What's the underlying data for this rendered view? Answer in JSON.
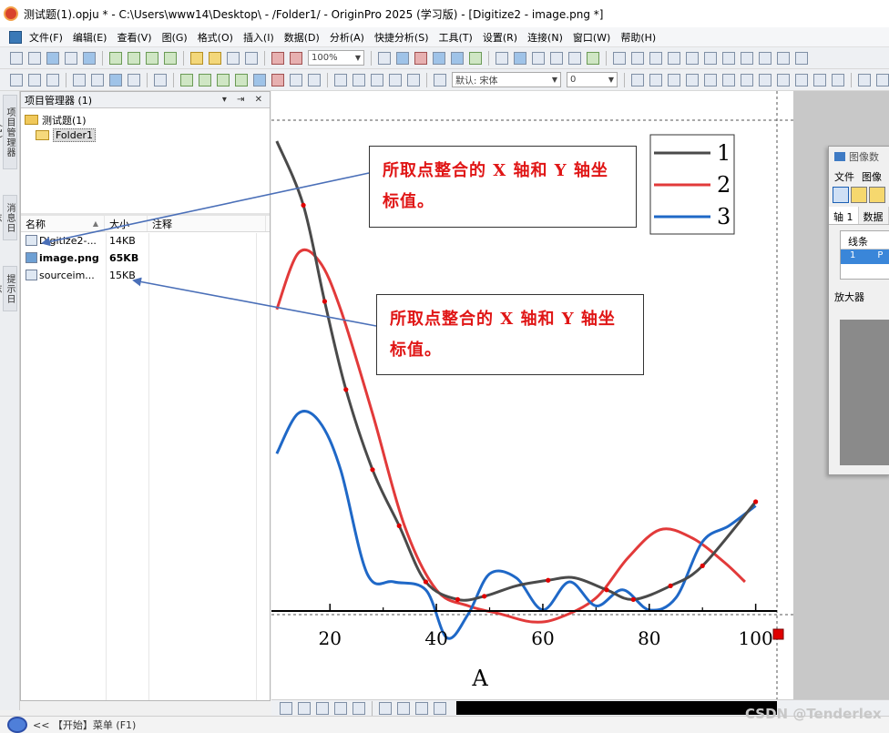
{
  "window": {
    "title": "测试题(1).opju * - C:\\Users\\www14\\Desktop\\ - /Folder1/ - OriginPro 2025 (学习版) - [Digitize2 - image.png *]"
  },
  "menu": [
    "文件(F)",
    "编辑(E)",
    "查看(V)",
    "图(G)",
    "格式(O)",
    "插入(I)",
    "数据(D)",
    "分析(A)",
    "快捷分析(S)",
    "工具(T)",
    "设置(R)",
    "连接(N)",
    "窗口(W)",
    "帮助(H)"
  ],
  "toolbar": {
    "zoom_value": "100%",
    "font_label": "默认: 宋体",
    "font_size": "0"
  },
  "side_tabs": [
    "项目管理器 (1)",
    "消息日志",
    "提示日志"
  ],
  "project_explorer": {
    "title": "项目管理器 (1)",
    "tree": {
      "root": "测试题(1)",
      "folder": "Folder1"
    },
    "columns": {
      "name": "名称",
      "size": "大小",
      "note": "注释"
    },
    "files": [
      {
        "name": "Digitize2-...",
        "size": "14KB",
        "bold": false,
        "icon": "graph-window-icon"
      },
      {
        "name": "image.png",
        "size": "65KB",
        "bold": true,
        "icon": "image-window-icon"
      },
      {
        "name": "sourceim...",
        "size": "15KB",
        "bold": false,
        "icon": "graph-window-icon"
      }
    ]
  },
  "chart_data": {
    "type": "line",
    "xlabel": "A",
    "ylabel": "",
    "x_ticks": [
      20,
      40,
      60,
      80,
      100
    ],
    "xlim": [
      9,
      104
    ],
    "legend": {
      "position": "top-right",
      "entries": [
        "1",
        "2",
        "3"
      ]
    },
    "colors": {
      "1": "#4a4a4a",
      "2": "#e23a3a",
      "3": "#1f68c7",
      "points": "#e00000"
    },
    "series": [
      {
        "name": "1",
        "x": [
          10,
          15,
          19,
          23,
          28,
          33,
          38,
          44,
          49,
          55,
          61,
          66,
          72,
          77,
          84,
          90,
          100
        ],
        "y": [
          5.0,
          4.2,
          3.0,
          1.9,
          0.9,
          0.2,
          -0.5,
          -0.72,
          -0.68,
          -0.55,
          -0.48,
          -0.45,
          -0.6,
          -0.72,
          -0.55,
          -0.3,
          0.5
        ]
      },
      {
        "name": "2",
        "x": [
          10,
          14,
          18,
          22,
          28,
          34,
          40,
          46,
          52,
          58,
          63,
          70,
          76,
          82,
          88,
          94,
          98
        ],
        "y": [
          2.9,
          3.6,
          3.5,
          2.9,
          1.6,
          0.2,
          -0.6,
          -0.8,
          -0.9,
          -1.0,
          -0.95,
          -0.7,
          -0.2,
          0.15,
          0.05,
          -0.25,
          -0.5
        ]
      },
      {
        "name": "3",
        "x": [
          10,
          14,
          18,
          22,
          27,
          32,
          38,
          42,
          46,
          50,
          55,
          60,
          65,
          70,
          75,
          80,
          85,
          90,
          95,
          100
        ],
        "y": [
          1.1,
          1.6,
          1.5,
          0.9,
          -0.4,
          -0.5,
          -0.6,
          -1.2,
          -0.9,
          -0.4,
          -0.45,
          -0.85,
          -0.5,
          -0.8,
          -0.6,
          -0.85,
          -0.7,
          0.0,
          0.2,
          0.45
        ]
      }
    ],
    "marked_points": {
      "x": [
        15,
        19,
        23,
        28,
        33,
        38,
        44,
        49,
        61,
        72,
        77,
        84,
        90,
        100
      ],
      "y": [
        4.2,
        3.0,
        1.9,
        0.9,
        0.2,
        -0.5,
        -0.72,
        -0.68,
        -0.48,
        -0.6,
        -0.72,
        -0.55,
        -0.3,
        0.5
      ]
    }
  },
  "callouts": [
    {
      "text": "所取点整合的 X 轴和 Y 轴坐标值。"
    },
    {
      "text": "所取点整合的 X 轴和 Y 轴坐标值。"
    }
  ],
  "digitizer": {
    "title": "图像数",
    "menu1": "文件",
    "menu2": "图像",
    "tab1": "轴 1",
    "tab2": "数据",
    "table_header": "线条",
    "row_index": "1",
    "row_label": "P",
    "magnifier_label": "放大器"
  },
  "statusbar": {
    "text": "<< 【开始】菜单 (F1)"
  },
  "watermark": "CSDN @Tenderlex"
}
